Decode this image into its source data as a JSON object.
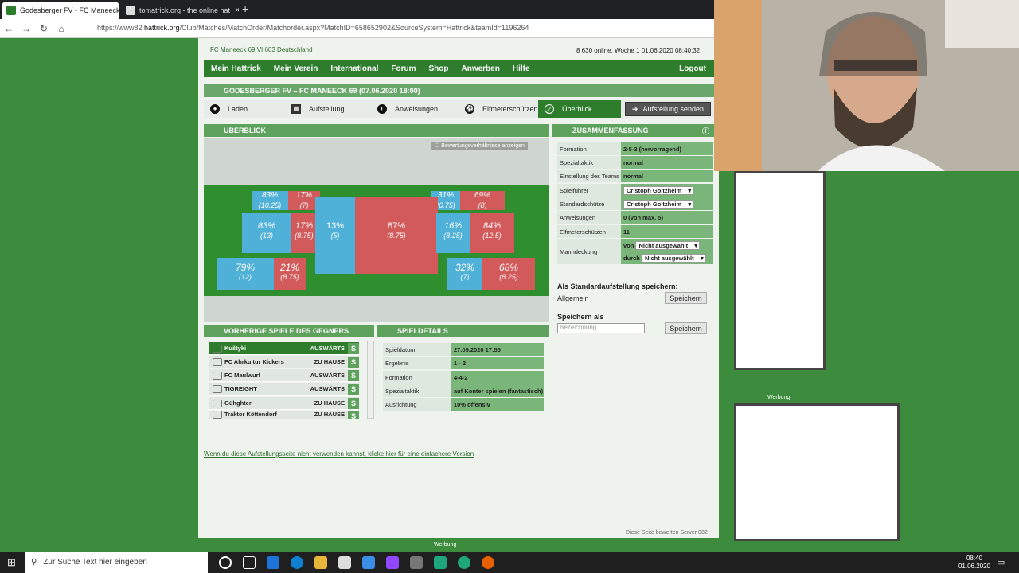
{
  "browser": {
    "tabs": [
      {
        "title": "Godesberger FV - FC Maneeck"
      },
      {
        "title": "tomatrick.org - the online hat"
      }
    ],
    "new_tab": "+",
    "url_prefix": "https://www82.",
    "url_domain": "hattrick.org",
    "url_rest": "/Club/Matches/MatchOrder/Matchorder.aspx?MatchID=658652902&SourceSystem=Hattrick&teamId=1196264"
  },
  "header": {
    "club_info": "FC Maneeck 69 VI.603 Deutschland",
    "online_info": "8 630 online, Woche 1 01.06.2020 08:40:32"
  },
  "nav": [
    "Mein Hattrick",
    "Mein Verein",
    "International",
    "Forum",
    "Shop",
    "Anwerben",
    "Hilfe"
  ],
  "logout": "Logout",
  "match_title": "GODESBERGER FV – FC MANEECK 69 (07.06.2020 18:00)",
  "steps": [
    "Laden",
    "Aufstellung",
    "Anweisungen",
    "Elfmeterschützen",
    "Überblick"
  ],
  "send_button": "Aufstellung senden",
  "overview": {
    "title": "ÜBERBLICK",
    "rating_checkbox": "Bewertungsverhältnisse anzeigen",
    "zones": [
      {
        "pct": "83%",
        "val": "(10.25)"
      },
      {
        "pct": "17%",
        "val": "(7)"
      },
      {
        "pct": "31%",
        "val": "(6.75)"
      },
      {
        "pct": "69%",
        "val": "(8)"
      },
      {
        "pct": "83%",
        "val": "(13)"
      },
      {
        "pct": "17%",
        "val": "(8.75)"
      },
      {
        "pct": "13%",
        "val": "(5)"
      },
      {
        "pct": "87%",
        "val": "(8.75)"
      },
      {
        "pct": "16%",
        "val": "(8.25)"
      },
      {
        "pct": "84%",
        "val": "(12.5)"
      },
      {
        "pct": "79%",
        "val": "(12)"
      },
      {
        "pct": "21%",
        "val": "(8.75)"
      },
      {
        "pct": "32%",
        "val": "(7)"
      },
      {
        "pct": "68%",
        "val": "(8.25)"
      }
    ]
  },
  "summary": {
    "title": "ZUSAMMENFASSUNG",
    "rows": [
      {
        "k": "Formation",
        "v": "2-5-3 (hervorragend)"
      },
      {
        "k": "Spezialtaktik",
        "v": "normal"
      },
      {
        "k": "Einstellung des Teams",
        "v": "normal"
      },
      {
        "k": "Spielführer",
        "v": "Cristoph Goltzheim"
      },
      {
        "k": "Standardschütze",
        "v": "Cristoph Goltzheim"
      },
      {
        "k": "Anweisungen",
        "v": "0 (von max. 5)"
      },
      {
        "k": "Elfmeterschützen",
        "v": "11"
      }
    ],
    "mandeckung_label": "Manndeckung",
    "von": "von",
    "von_value": "Nicht ausgewählt",
    "durch": "durch",
    "durch_value": "Nicht ausgewählt",
    "save_default_title": "Als Standardaufstellung speichern:",
    "general": "Allgemein",
    "save": "Speichern",
    "save_as": "Speichern als",
    "name_placeholder": "Bezeichnung"
  },
  "previous": {
    "title": "VORHERIGE SPIELE DES GEGNERS",
    "rows": [
      {
        "team": "Kuštyki",
        "where": "AUSWÄRTS",
        "s": "S"
      },
      {
        "team": "FC Ahrkultur Kickers",
        "where": "ZU HAUSE",
        "s": "S"
      },
      {
        "team": "FC Maulwurf",
        "where": "AUSWÄRTS",
        "s": "S"
      },
      {
        "team": "TIGREIGHT",
        "where": "AUSWÄRTS",
        "s": "S"
      },
      {
        "team": "Gühghter",
        "where": "ZU HAUSE",
        "s": "S"
      },
      {
        "team": "Traktor Köttendorf",
        "where": "ZU HAUSE",
        "s": "S"
      }
    ]
  },
  "details": {
    "title": "SPIELDETAILS",
    "rows": [
      {
        "k": "Spieldatum",
        "v": "27.05.2020 17:55"
      },
      {
        "k": "Ergebnis",
        "v": "1 - 2"
      },
      {
        "k": "Formation",
        "v": "4-4-2"
      },
      {
        "k": "Spezialtaktik",
        "v": "auf Konter spielen (fantastisch)"
      },
      {
        "k": "Ausrichtung",
        "v": "10% offensiv"
      }
    ]
  },
  "simple_link": "Wenn du diese Aufstellungsseite nicht verwenden kannst, klicke hier für eine einfachere Version",
  "footer": "Diese Seite bewerten Server 082",
  "ad_label": "Werbung",
  "taskbar": {
    "search_placeholder": "Zur Suche Text hier eingeben",
    "time": "08:40",
    "date": "01.06.2020"
  },
  "colors": {
    "green": "#2d7d2d",
    "blue": "#4fb0d8",
    "red": "#d25a5a"
  }
}
